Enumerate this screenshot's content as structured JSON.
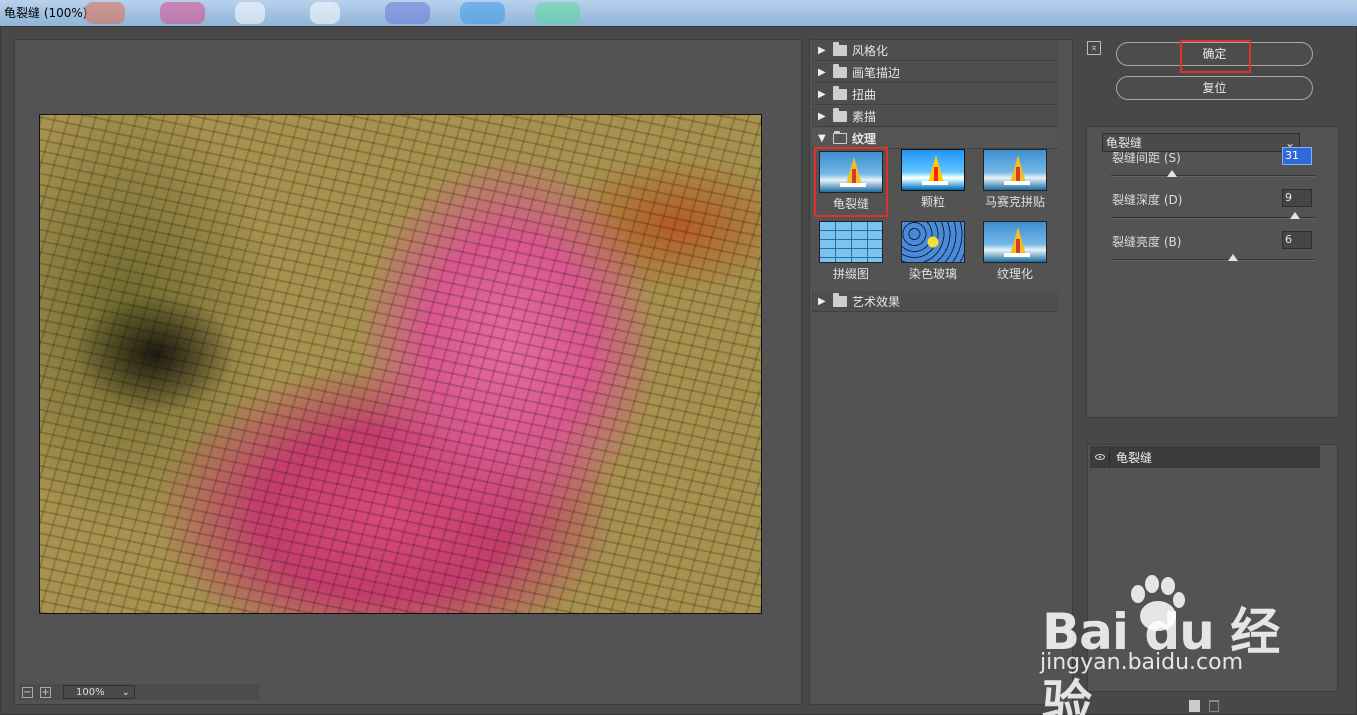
{
  "window": {
    "title": "龟裂缝 (100%)"
  },
  "preview": {
    "zoom": "100%",
    "zoom_out": "−",
    "zoom_in": "+"
  },
  "gallery": {
    "categories_top": [
      {
        "label": "风格化"
      },
      {
        "label": "画笔描边"
      },
      {
        "label": "扭曲"
      },
      {
        "label": "素描"
      }
    ],
    "open_category": {
      "label": "纹理"
    },
    "thumbnails": [
      {
        "label": "龟裂缝",
        "selected": true
      },
      {
        "label": "颗粒"
      },
      {
        "label": "马赛克拼贴"
      },
      {
        "label": "拼缀图"
      },
      {
        "label": "染色玻璃"
      },
      {
        "label": "纹理化"
      }
    ],
    "categories_bottom": [
      {
        "label": "艺术效果"
      }
    ]
  },
  "controls": {
    "ok_label": "确定",
    "reset_label": "复位",
    "filter_select": "龟裂缝",
    "params": [
      {
        "label": "裂缝间距 (S)",
        "value": "31",
        "level": 0.3
      },
      {
        "label": "裂缝深度 (D)",
        "value": "9",
        "level": 0.9
      },
      {
        "label": "裂缝亮度 (B)",
        "value": "6",
        "level": 0.6
      }
    ]
  },
  "layers": [
    {
      "name": "龟裂缝"
    }
  ],
  "watermark": {
    "brand": "Bai du 经验",
    "url": "jingyan.baidu.com"
  },
  "colors": {
    "highlight": "#e0302a",
    "panel": "#535353",
    "focus": "#2f6bd8"
  }
}
